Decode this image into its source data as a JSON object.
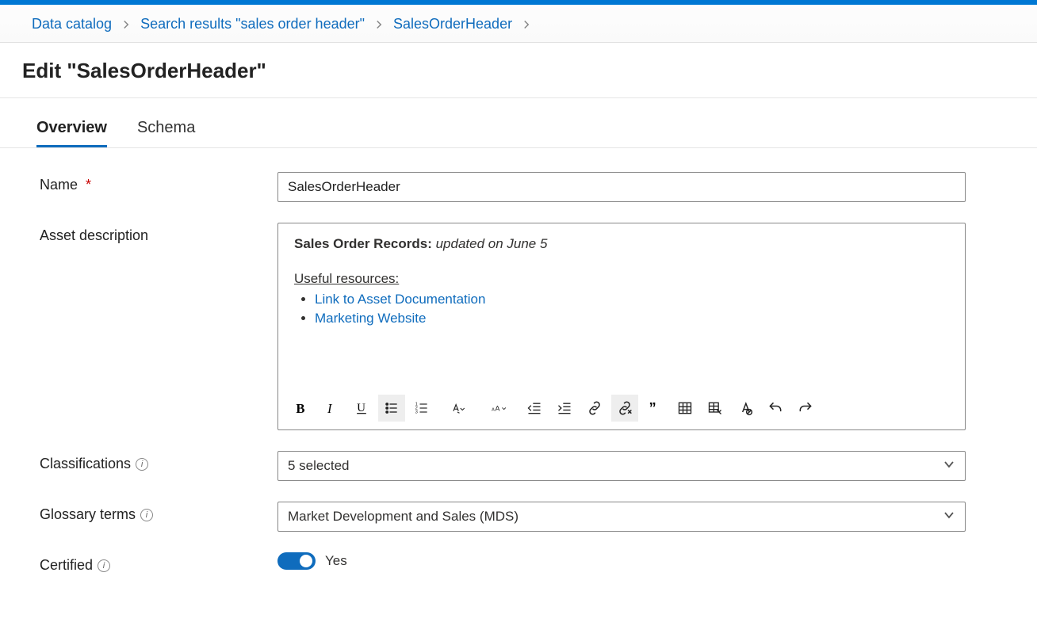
{
  "breadcrumb": {
    "items": [
      {
        "label": "Data catalog"
      },
      {
        "label": "Search results \"sales order header\""
      },
      {
        "label": "SalesOrderHeader"
      }
    ]
  },
  "page": {
    "title": "Edit \"SalesOrderHeader\""
  },
  "tabs": [
    {
      "label": "Overview",
      "active": true
    },
    {
      "label": "Schema",
      "active": false
    }
  ],
  "form": {
    "name": {
      "label": "Name",
      "required_marker": "*",
      "value": "SalesOrderHeader"
    },
    "description": {
      "label": "Asset description",
      "header_bold": "Sales Order Records:",
      "header_italic": " updated on June 5",
      "resources_heading": "Useful resources:",
      "links": [
        {
          "text": "Link to Asset Documentation"
        },
        {
          "text": "Marketing Website"
        }
      ]
    },
    "classifications": {
      "label": "Classifications",
      "value": "5 selected"
    },
    "glossary": {
      "label": "Glossary terms",
      "value": "Market Development and Sales (MDS)"
    },
    "certified": {
      "label": "Certified",
      "value_text": "Yes",
      "on": true
    }
  },
  "toolbar": {
    "buttons": [
      "bold",
      "italic",
      "underline",
      "bullets",
      "numbers",
      "font-color",
      "font-size",
      "outdent",
      "indent",
      "link",
      "unlink",
      "quote",
      "table",
      "table-edit",
      "clear-format",
      "undo",
      "redo"
    ]
  }
}
